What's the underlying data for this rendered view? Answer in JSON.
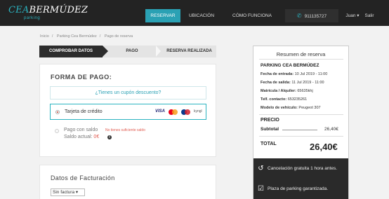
{
  "header": {
    "logo_main_a": "CEA",
    "logo_main_b": "BERMÚDEZ",
    "logo_sub": "parking",
    "nav": {
      "reservar": "RESERVAR",
      "ubicacion": "UBICACIÓN",
      "como_funciona": "CÓMO FUNCIONA",
      "phone": "911135727",
      "user": "Juan ▾",
      "salir": "Salir"
    }
  },
  "breadcrumb": [
    "Inicio",
    "Parking Cea Bermúdez",
    "Pago de reserva"
  ],
  "steps": [
    "COMPROBAR DATOS",
    "PAGO",
    "RESERVA REALIZADA"
  ],
  "payment": {
    "title": "FORMA DE PAGO:",
    "coupon": "¿Tienes un cupón descuento?",
    "credit_card_label": "Tarjeta de crédito",
    "card_brands": {
      "visa": "VISA",
      "other": "kyngl"
    },
    "saldo_label": "Pago con saldo",
    "saldo_warning": "No tienes suficiente saldo",
    "saldo_actual_label": "Saldo actual: ",
    "saldo_actual_value": "0€"
  },
  "billing": {
    "title": "Datos de Facturación",
    "select_value": "Sin factura ▾"
  },
  "summary": {
    "title": "Resumen de reserva",
    "parking": "PARKING CEA BERMÚDEZ",
    "fecha_entrada_label": "Fecha de entrada:",
    "fecha_entrada": " 10 Jul 2019 - 11:00",
    "fecha_salida_label": "Fecha de salida:",
    "fecha_salida": " 11 Jul 2019 - 11:00",
    "matricula_label": "Matrícula / Alquiler:",
    "matricula": " 65635khj",
    "telefono_label": "Telf. contacto:",
    "telefono": " 653235261",
    "modelo_label": "Modelo de vehículo:",
    "modelo": " Peugeot 307",
    "precio_label": "PRECIO",
    "subtotal_label": "Subtotal",
    "subtotal": "26,40€",
    "total_label": "TOTAL",
    "total": "26,40€",
    "features": [
      "Cancelación gratuita 1 hora antes.",
      "Plaza de parking garantizada."
    ]
  },
  "colors": {
    "accent": "#2aa1b4",
    "header": "#232323",
    "warning": "#e05a4f"
  },
  "icons": [
    "phone-icon",
    "info-icon",
    "cancel-clock-icon",
    "calendar-check-icon"
  ]
}
